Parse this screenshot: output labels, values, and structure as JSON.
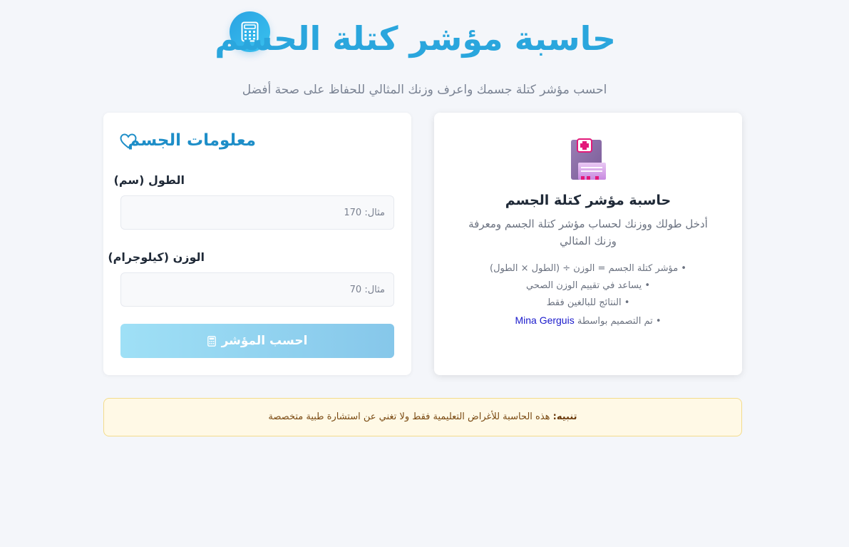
{
  "header": {
    "title": "حاسبة مؤشر كتلة الحسم",
    "subtitle": "احسب مؤشر كتلة جسمك واعرف وزنك المثالي للحفاظ على صحة أفضل"
  },
  "form": {
    "title": "معلومات الجسم",
    "height_label": "الطول (سم)",
    "height_placeholder": "مثال: 170",
    "weight_label": "الوزن (كيلوجرام)",
    "weight_placeholder": "مثال: 70",
    "calculate_label": "احسب المؤشر"
  },
  "info": {
    "title": "حاسبة مؤشر كتلة الجسم",
    "description": "أدخل طولك ووزنك لحساب مؤشر كتلة الجسم ومعرفة وزنك المثالي",
    "items": [
      "• مؤشر كتلة الجسم = الوزن ÷ (الطول × الطول)",
      "• يساعد في تقييم الوزن الصحي",
      "• النتائج للبالغين فقط"
    ],
    "credit_prefix": "• تم التصميم بواسطة",
    "credit_author": "Mina Gerguis"
  },
  "warning": {
    "label": "تنبيه:",
    "text": "هذه الحاسبة للأغراض التعليمية فقط ولا تغني عن استشارة طبية متخصصة"
  },
  "colors": {
    "accent": "#2aa6dd",
    "button_start": "#86c7ea",
    "button_end": "#9fe0f6",
    "warning_bg": "#fff9e6"
  },
  "icons": {
    "logo": "calculator-icon",
    "form_heading": "heart-icon",
    "info_card": "medical-clipboard-icon"
  }
}
